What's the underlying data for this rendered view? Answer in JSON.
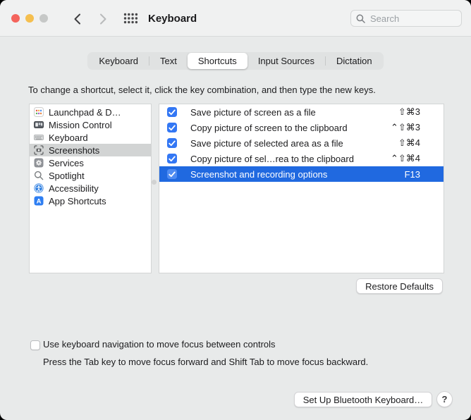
{
  "titlebar": {
    "title": "Keyboard",
    "search_placeholder": "Search"
  },
  "tabs": [
    {
      "label": "Keyboard",
      "selected": false
    },
    {
      "label": "Text",
      "selected": false
    },
    {
      "label": "Shortcuts",
      "selected": true
    },
    {
      "label": "Input Sources",
      "selected": false
    },
    {
      "label": "Dictation",
      "selected": false
    }
  ],
  "instruction": "To change a shortcut, select it, click the key combination, and then type the new keys.",
  "sidebar": {
    "items": [
      {
        "label": "Launchpad & D…",
        "icon": "launchpad-icon",
        "selected": false
      },
      {
        "label": "Mission Control",
        "icon": "mission-control-icon",
        "selected": false
      },
      {
        "label": "Keyboard",
        "icon": "keyboard-icon",
        "selected": false
      },
      {
        "label": "Screenshots",
        "icon": "screenshots-icon",
        "selected": true
      },
      {
        "label": "Services",
        "icon": "services-gear-icon",
        "selected": false
      },
      {
        "label": "Spotlight",
        "icon": "spotlight-magnifier-icon",
        "selected": false
      },
      {
        "label": "Accessibility",
        "icon": "accessibility-icon",
        "selected": false
      },
      {
        "label": "App Shortcuts",
        "icon": "app-shortcuts-icon",
        "selected": false
      }
    ]
  },
  "shortcuts": {
    "rows": [
      {
        "checked": true,
        "label": "Save picture of screen as a file",
        "keys": "⇧⌘3",
        "selected": false
      },
      {
        "checked": true,
        "label": "Copy picture of screen to the clipboard",
        "keys": "⌃⇧⌘3",
        "selected": false
      },
      {
        "checked": true,
        "label": "Save picture of selected area as a file",
        "keys": "⇧⌘4",
        "selected": false
      },
      {
        "checked": true,
        "label": "Copy picture of sel…rea to the clipboard",
        "keys": "⌃⇧⌘4",
        "selected": false
      },
      {
        "checked": true,
        "label": "Screenshot and recording options",
        "keys": "F13",
        "selected": true
      }
    ]
  },
  "buttons": {
    "restore_defaults": "Restore Defaults",
    "setup_bluetooth": "Set Up Bluetooth Keyboard…",
    "help": "?"
  },
  "footer": {
    "keyboard_nav_checked": false,
    "keyboard_nav_label": "Use keyboard navigation to move focus between controls",
    "keyboard_nav_hint": "Press the Tab key to move focus forward and Shift Tab to move focus backward."
  },
  "colors": {
    "selection_blue": "#2069e0",
    "checkbox_blue": "#3377f4",
    "sidebar_selected_gray": "#d2d4d4",
    "titlebar_bg": "#f0f1f1",
    "window_bg": "#e8eaea"
  }
}
